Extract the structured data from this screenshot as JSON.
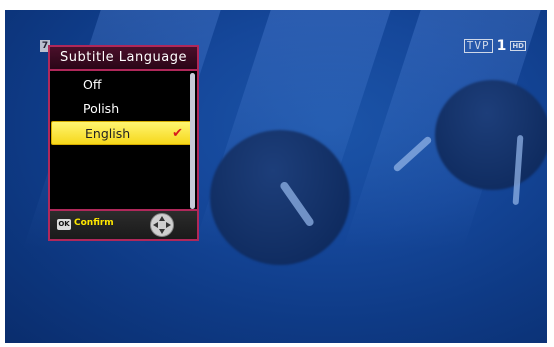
{
  "channel": {
    "logo_text": "TVP",
    "number": "1",
    "hd_badge": "HD"
  },
  "corner_badge": "7",
  "menu": {
    "title": "Subtitle Language",
    "items": [
      {
        "label": "Off"
      },
      {
        "label": "Polish"
      },
      {
        "label": "English",
        "selected": true,
        "mark": "✔"
      }
    ]
  },
  "footer": {
    "ok_label": "OK",
    "confirm_label": "Confirm"
  },
  "colors": {
    "accent": "#b0285a",
    "selection": "#f6d81b",
    "check": "#d81c1c",
    "confirm_text": "#ffe800"
  },
  "icons": [
    "ok-key-icon",
    "dpad-icon",
    "checkmark-icon"
  ]
}
